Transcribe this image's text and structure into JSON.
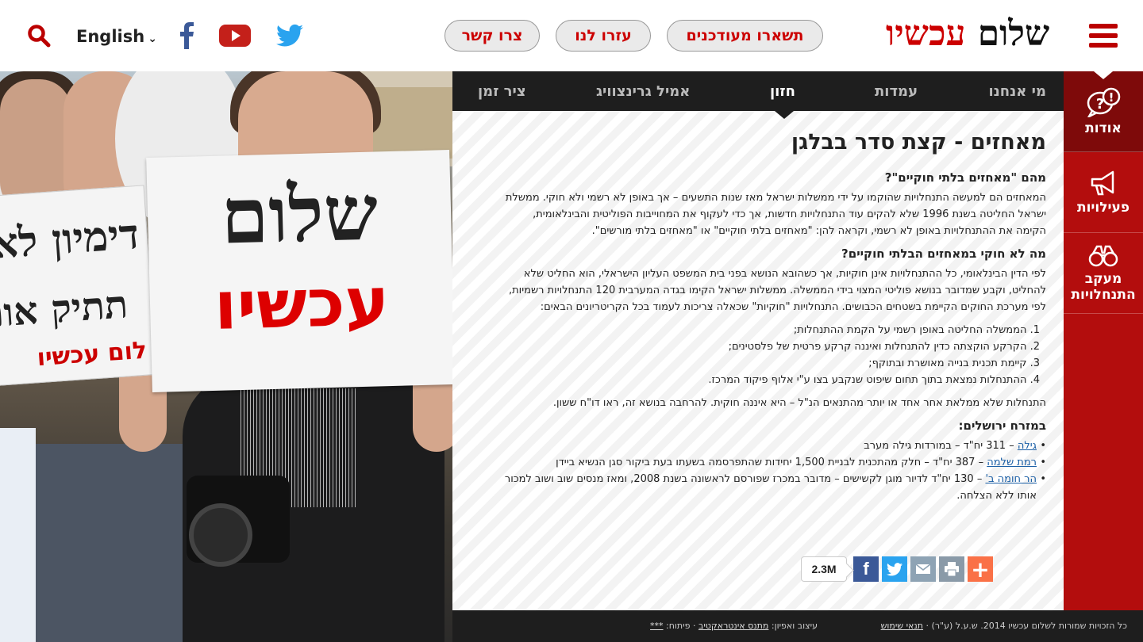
{
  "header": {
    "language": "English",
    "buttons": {
      "contact": "צרו קשר",
      "help": "עזרו לנו",
      "updated": "תשארו מעודכנים"
    },
    "logo": {
      "word1": "שלום",
      "word2": "עכשיו"
    }
  },
  "photo": {
    "sign_main": {
      "line1": "שלום",
      "line2": "עכשיו"
    },
    "sign_left": {
      "line1": "דימיון לא",
      "line2": "תתיק אות",
      "line3": "לום עכשיו"
    }
  },
  "nav": {
    "about": "מי אנחנו",
    "positions": "עמדות",
    "vision": "חזון",
    "emil": "אמיל גרינצוויג",
    "timeline": "ציר זמן"
  },
  "sidebar": {
    "about": "אודות",
    "activities": "פעילויות",
    "monitor": "מעקב התנחלויות"
  },
  "article": {
    "title": "מאחזים - קצת סדר בבלגן",
    "h1": "מהם \"מאחזים בלתי חוקיים\"?",
    "p1": "המאחזים הם למעשה התנחלויות שהוקמו על ידי ממשלות ישראל מאז שנות התשעים – אך באופן לא רשמי ולא חוקי. ממשלת ישראל החליטה בשנת 1996 שלא להקים עוד התנחלויות חדשות, אך כדי לעקוף את המחוייבות הפוליטית והבינלאומית, הקימה את ההתנחלויות באופן לא רשמי, וקראה להן: \"מאחזים בלתי חוקיים\" או \"מאחזים בלתי מורשים\".",
    "h2": "מה לא חוקי במאחזים הבלתי חוקיים?",
    "p2": "לפי הדין הבינלאומי, כל ההתנחלויות אינן חוקיות, אך כשהובא הנושא בפני בית המשפט העליון הישראלי, הוא החליט שלא להחליט, וקבע שמדובר בנושא פוליטי המצוי בידי הממשלה. ממשלות ישראל הקימו בגדה המערבית 120 התנחלויות רשמיות, לפי מערכת החוקים הקיימת בשטחים הכבושים. התנחלויות \"חוקיות\" שכאלה צריכות לעמוד בכל הקריטריונים הבאים:",
    "criteria": [
      "1. הממשלה החליטה באופן רשמי על הקמת ההתנחלות;",
      "2. הקרקע הוקצתה כדין להתנחלות ואיננה קרקע פרטית של פלסטינים;",
      "3. קיימת תכנית בנייה מאושרת ובתוקף;",
      "4. ההתנחלות נמצאת בתוך תחום שיפוט שנקבע בצו ע\"י אלוף פיקוד המרכז."
    ],
    "p3": "התנחלות שלא ממלאת אחר אחד או יותר מהתנאים הנ\"ל – היא איננה חוקית. להרחבה בנושא זה, ראו דו\"ח ששון.",
    "h3": "במזרח ירושלים:",
    "items": [
      {
        "link": "גילה",
        "text": " – 311 יח\"ד – במורדות גילה מערב"
      },
      {
        "link": "רמת שלמה",
        "text": " – 387 יח\"ד – חלק מהתכנית לבניית 1,500 יחידות שהתפרסמה בשעתו בעת ביקור סגן הנשיא ביידן"
      },
      {
        "link": "הר חומה ב'",
        "text": " – 130 יח\"ד לדיור מוגן לקשישים – מדובר במכרז שפורסם לראשונה בשנת 2008, ומאז מנסים שוב ושוב למכור אותו ללא הצלחה."
      }
    ]
  },
  "share": {
    "count": "2.3M"
  },
  "footer": {
    "copyright": "כל הזכויות שמורות לשלום עכשיו 2014. ש.ע.ל (ע\"ר) · ",
    "terms": "תנאי שימוש",
    "design_label": "עיצוב ואפיון: ",
    "design_link": "מתנס אינטראקטיב",
    "dev_label": " · פיתוח: ",
    "dev_link": "***"
  },
  "colors": {
    "brand_red": "#b30d0d",
    "dark_red": "#7e0a0a",
    "nav_bg": "#1e1e1e",
    "link": "#1b5fa6"
  },
  "icons": [
    "search-icon",
    "facebook-icon",
    "youtube-icon",
    "twitter-icon",
    "menu-icon",
    "question-bubble-icon",
    "megaphone-icon",
    "binoculars-icon",
    "facebook-share-icon",
    "twitter-share-icon",
    "mail-icon",
    "print-icon",
    "plus-icon"
  ]
}
